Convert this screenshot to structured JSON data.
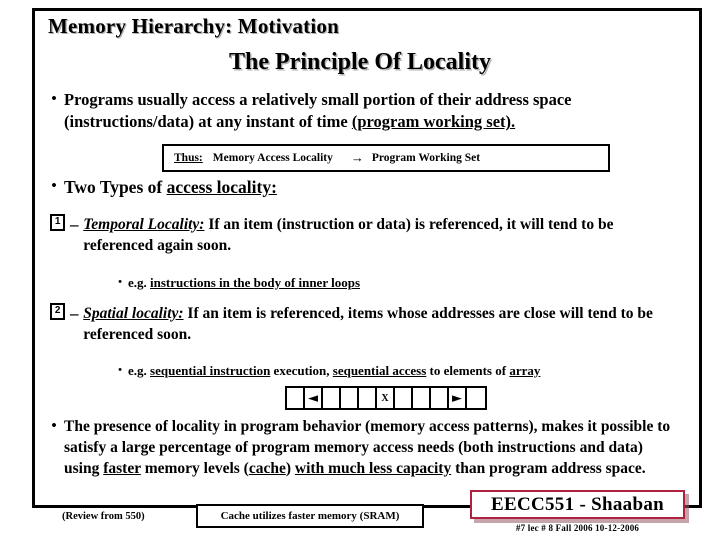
{
  "slide": {
    "title": "Memory Hierarchy:  Motivation",
    "subtitle": "The Principle Of Locality"
  },
  "bullets": {
    "b1_part1": "Programs usually access a relatively small portion of their address space (instructions/data) at any instant of time ",
    "b1_underlined": "(program working set).",
    "b2_prefix": "Two Types of ",
    "b2_underlined": "access locality:",
    "b2_full": "Two Types of access locality:"
  },
  "thus_box": {
    "label": "Thus:",
    "left_term": "Memory Access Locality",
    "arrow": "→",
    "right_term": "Program Working Set"
  },
  "temporal": {
    "number": "1",
    "dash": "–",
    "term": "Temporal Locality:",
    "text": "  If an item (instruction or data)  is referenced, it will tend to be referenced again soon.",
    "example_prefix": "e.g. ",
    "example_underlined": "instructions in the body of inner loops"
  },
  "spatial": {
    "number": "2",
    "dash": "–",
    "term": "Spatial locality:",
    "text": "  If an item is referenced, items whose addresses are close will tend to be referenced soon.",
    "example_prefix": "e.g. ",
    "example_u1": "sequential instruction",
    "example_mid": " execution, ",
    "example_u2": "sequential access",
    "example_tail": " to elements of ",
    "example_u3": "array"
  },
  "array_diagram": {
    "cells": [
      "",
      "◄",
      "",
      "",
      "",
      "X",
      "",
      "",
      "",
      "►",
      ""
    ],
    "center_label": "X",
    "left_arrow": "◄",
    "right_arrow": "►"
  },
  "conclusion": {
    "part1": "The presence of locality in program behavior (memory access patterns), makes it possible to satisfy a large percentage of program memory access needs (both instructions and data) using ",
    "u1": "faster",
    "part2": " memory levels (",
    "u2": "cache",
    "part3": ") ",
    "u3": "with much less capacity",
    "part4": " than program address space."
  },
  "footer": {
    "review_note": "(Review from 550)",
    "cache_box": "Cache utilizes faster memory (SRAM)",
    "badge": "EECC551 - Shaaban",
    "badge_sub": "#7  lec # 8   Fall 2006  10-12-2006",
    "badge_border_color": "#b02040"
  }
}
